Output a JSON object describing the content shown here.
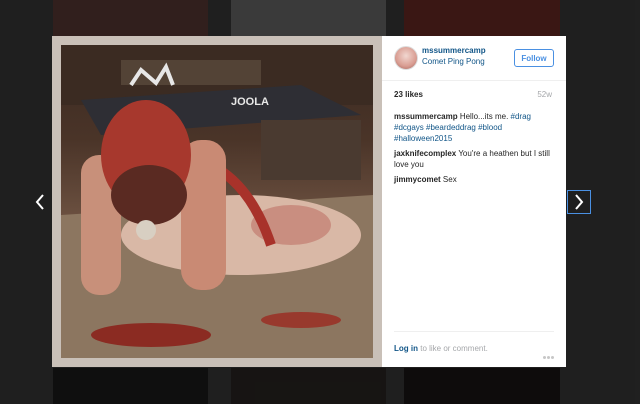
{
  "post": {
    "username": "mssummercamp",
    "location": "Comet Ping Pong",
    "follow_label": "Follow",
    "likes": "23 likes",
    "age": "52w",
    "comments": [
      {
        "user": "mssummercamp",
        "text_prefix": "Hello...its me. ",
        "tags": [
          "#drag",
          "#dcgays",
          "#beardeddrag",
          "#blood",
          "#halloween2015"
        ]
      },
      {
        "user": "jaxknifecomplex",
        "text": "You're a heathen but I still love you"
      },
      {
        "user": "jimmycomet",
        "text": "Sex"
      }
    ],
    "login": {
      "link": "Log in",
      "rest": " to like or comment."
    }
  },
  "photo": {
    "sign_text": "JOOLA"
  },
  "icons": {
    "prev": "chevron-left-icon",
    "next": "chevron-right-icon",
    "more": "more-options-icon"
  },
  "colors": {
    "link": "#125688",
    "follow": "#4a90e2",
    "muted": "#a5a7aa"
  }
}
